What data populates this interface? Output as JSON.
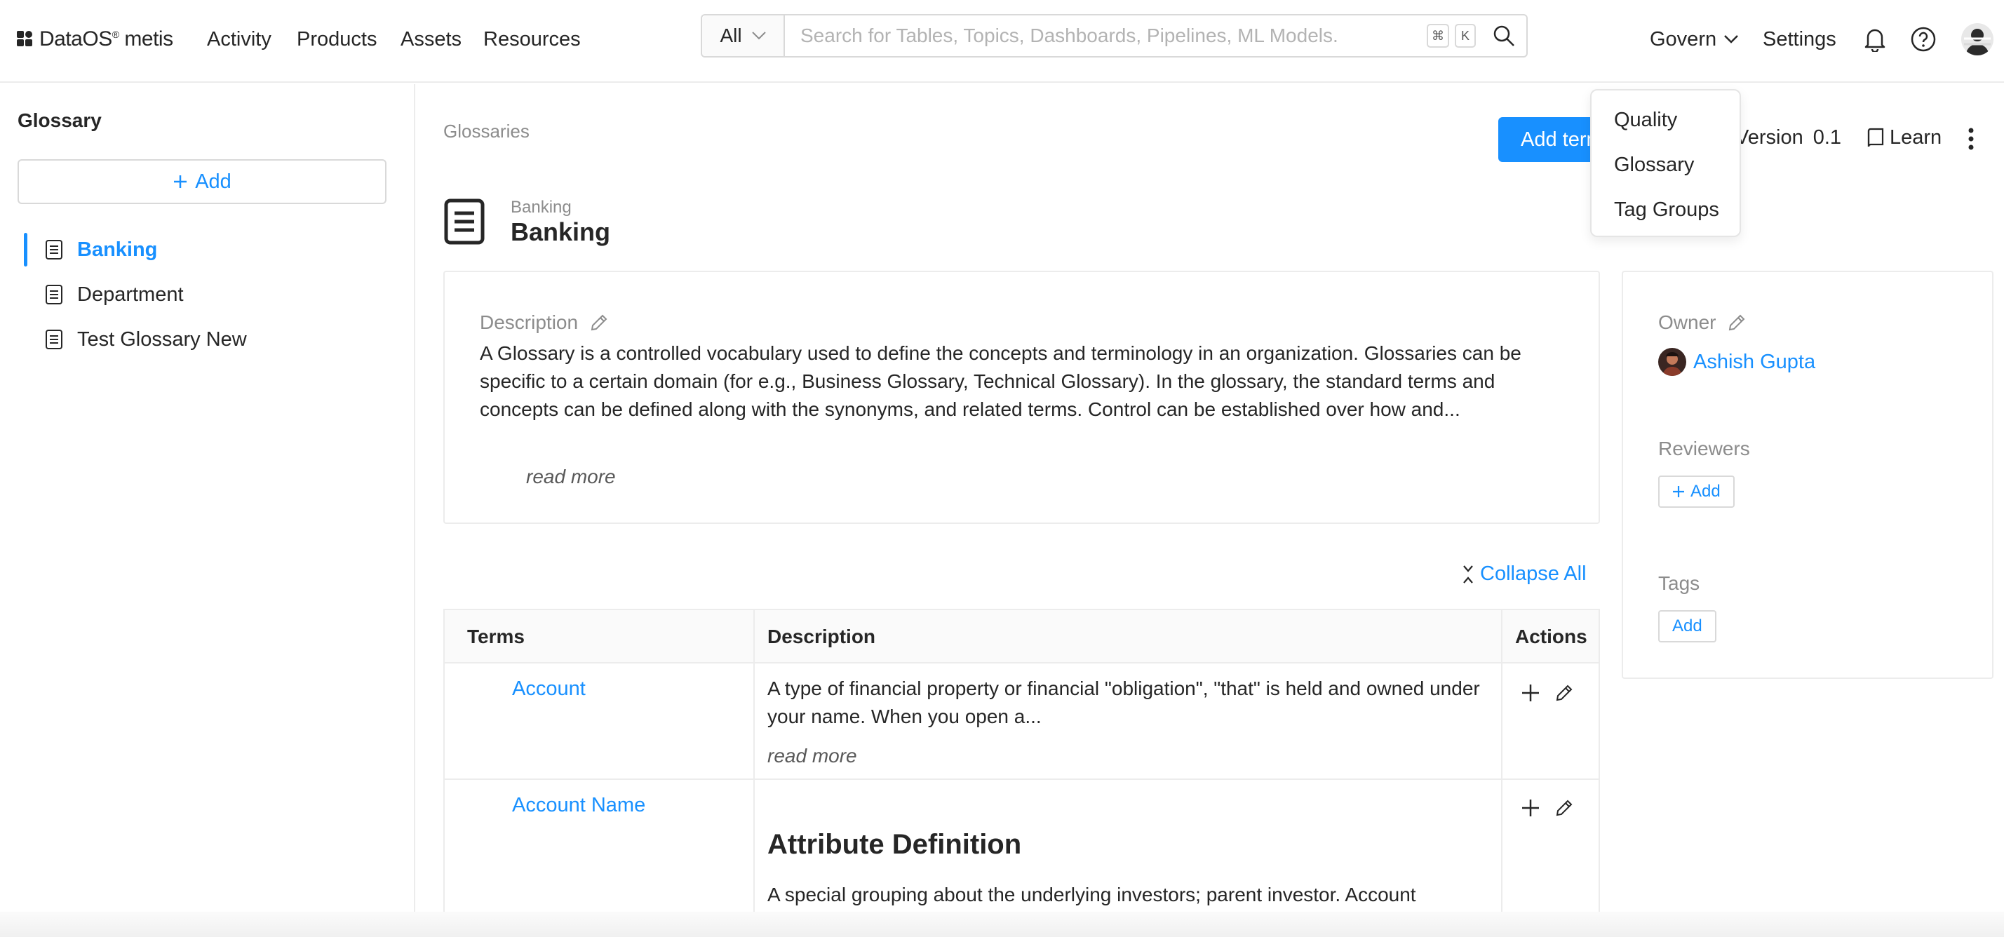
{
  "topbar": {
    "logo_brand": "DataOS",
    "logo_reg": "®",
    "logo_product": "metis",
    "nav": [
      "Activity",
      "Products",
      "Assets",
      "Resources"
    ],
    "search": {
      "filter_value": "All",
      "placeholder": "Search for Tables, Topics, Dashboards, Pipelines, ML Models.",
      "shortcut_cmd": "⌘",
      "shortcut_key": "K"
    },
    "govern_label": "Govern",
    "settings_label": "Settings"
  },
  "govern_menu": {
    "items": [
      "Quality",
      "Glossary",
      "Tag Groups"
    ]
  },
  "sidebar": {
    "title": "Glossary",
    "add_label": "Add",
    "items": [
      {
        "label": "Banking",
        "active": true
      },
      {
        "label": "Department",
        "active": false
      },
      {
        "label": "Test Glossary New",
        "active": false
      }
    ]
  },
  "main": {
    "breadcrumb": "Glossaries",
    "add_term_label": "Add term",
    "version_label": "Version",
    "version_value": "0.1",
    "learn_label": "Learn",
    "glossary_subtitle": "Banking",
    "glossary_title": "Banking",
    "description": {
      "label": "Description",
      "text": "A Glossary is a controlled vocabulary used to define the concepts and terminology in an organization. Glossaries can be specific to a certain domain (for e.g., Business Glossary, Technical Glossary). In the glossary, the standard terms and concepts can be defined along with the synonyms, and related terms. Control can be established over how and...",
      "read_more": "read more"
    },
    "collapse_all_label": "Collapse All",
    "table": {
      "headers": [
        "Terms",
        "Description",
        "Actions"
      ],
      "rows": [
        {
          "term": "Account",
          "description": "A type of financial property or financial \"obligation\", \"that\" is held and owned under your name. When you open a...",
          "read_more": "read more"
        },
        {
          "term": "Account Name",
          "heading": "Attribute Definition",
          "description": "A special grouping about the underlying investors; parent investor. Account"
        }
      ]
    }
  },
  "details": {
    "owner_label": "Owner",
    "owner_name": "Ashish Gupta",
    "reviewers_label": "Reviewers",
    "reviewers_add": "Add",
    "tags_label": "Tags",
    "tags_add": "Add"
  },
  "colors": {
    "accent": "#1890ff",
    "text": "#262626",
    "muted": "#8c8c8c",
    "border": "#ececec"
  }
}
